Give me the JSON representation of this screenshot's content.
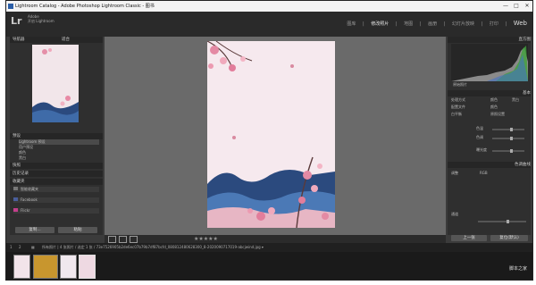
{
  "window": {
    "title": "Lightroom Catalog - Adobe Photoshop Lightroom Classic - 图书",
    "minimize_label": "—",
    "maximize_label": "□",
    "close_label": "✕"
  },
  "identity": {
    "logo": "Lr",
    "subtitle_line1": "Adobe",
    "subtitle_line2": "开启 Lightroom"
  },
  "modules": [
    "图库",
    "修改照片",
    "地图",
    "画册",
    "幻灯片放映",
    "打印",
    "Web"
  ],
  "active_module": "修改照片",
  "left_panel": {
    "navigator_title": "导航器",
    "navigator_zoom": "适合",
    "presets_title": "预设",
    "presets_items": [
      "Lightroom 预设",
      "用户预设",
      "颜色",
      "黑白"
    ],
    "snapshots_title": "快照",
    "history_title": "历史记录",
    "collections_title": "收藏夹",
    "collections_items": [
      "智能收藏夹",
      "Facebook",
      "Flickr"
    ],
    "copy_button": "复制...",
    "paste_button": "粘贴"
  },
  "right_panel": {
    "histogram_title": "直方图",
    "original_photo": "原始照片",
    "basic_title": "基本",
    "treatment_label": "处理方式",
    "treatment_color": "颜色",
    "treatment_bw": "黑白",
    "profile_label": "配置文件",
    "profile_value": "颜色",
    "wb_label": "白平衡",
    "wb_value": "原照设置",
    "temp_label": "色温",
    "tint_label": "色调",
    "tone_label": "色调",
    "exposure_label": "曝光度",
    "contrast_label": "对比度",
    "highlights_label": "高光",
    "shadows_label": "阴影",
    "tone_curve_title": "色调曲线",
    "region_label": "调整",
    "channel_label": "通道",
    "channel_value": "RGB",
    "prev_button": "上一张",
    "reset_button": "复位(默认)"
  },
  "toolbar": {
    "stars": "★★★★★"
  },
  "filmbar": {
    "page1": "1",
    "page2": "2",
    "path_text": "所有照片 | 4 张照片 / 选定 1 张 / 73e7526905b2de6ec07b79b7df87bcfd_080812480628300_8-2020090717019-abcjwind.jpg ▾"
  },
  "watermark": "脚本之家"
}
